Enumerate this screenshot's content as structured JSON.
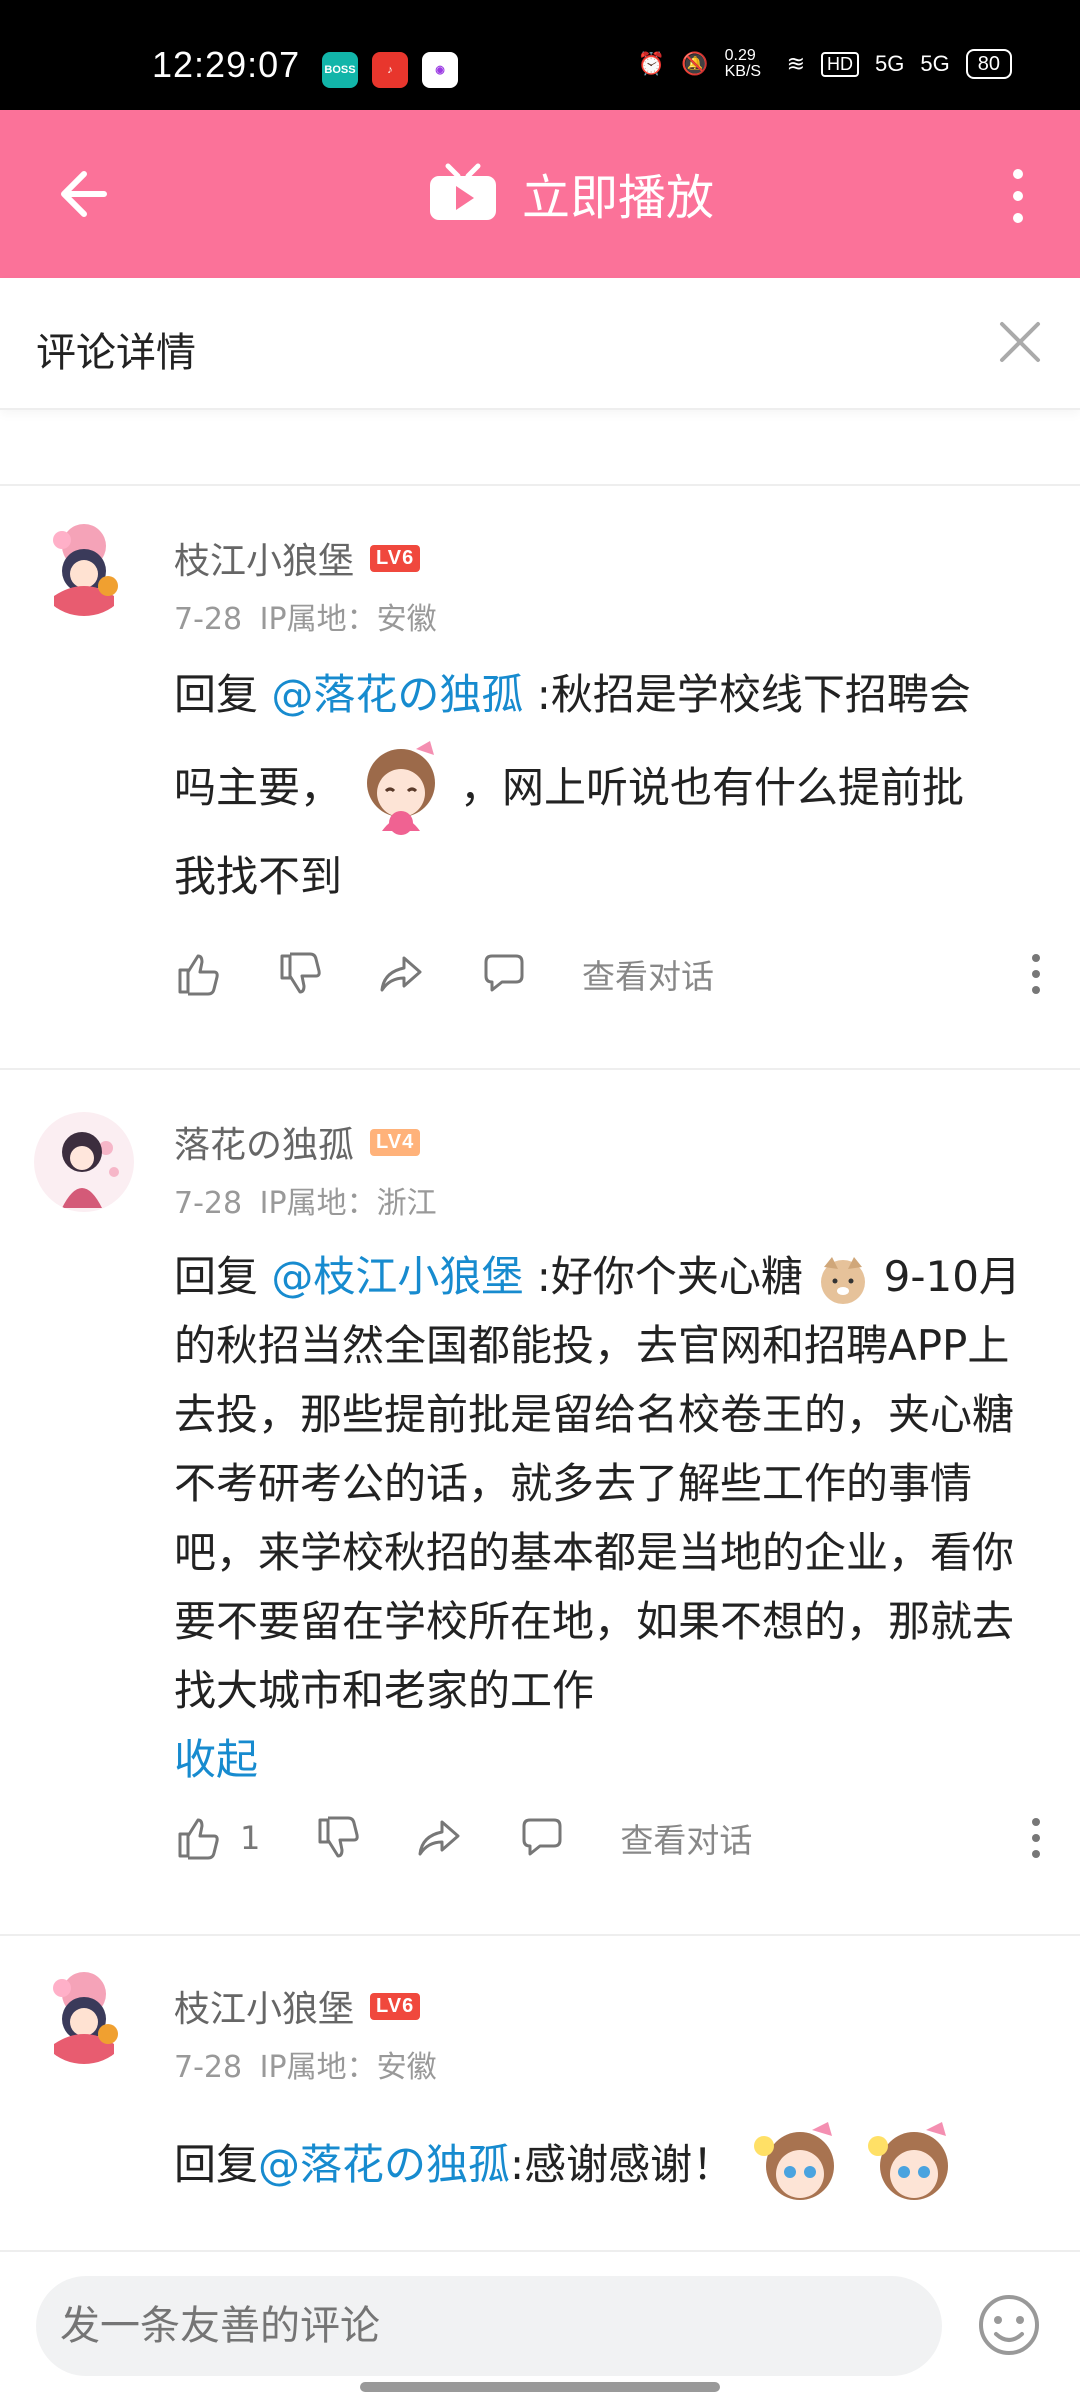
{
  "status_bar": {
    "time": "12:29:07",
    "apps": [
      "BOSS直聘",
      "抖音",
      "相机"
    ],
    "net_speed": "0.29 KB/S",
    "hd": "HD",
    "net1": "5G",
    "net2": "5G",
    "battery": "80"
  },
  "top_bar": {
    "play_label": "立即播放",
    "bg_color": "#fb7299"
  },
  "detail": {
    "title": "评论详情"
  },
  "comments": [
    {
      "user": "枝江小狼堡",
      "level": "LV6",
      "date": "7-28",
      "ip": "IP属地：安徽",
      "reply_prefix": "回复 ",
      "mention": "@落花の独孤",
      "text1": " :秋招是学校线下招聘会",
      "text2": "吗主要，",
      "text3": "，网上听说也有什么提前批",
      "text4": "我找不到",
      "view_conversation": "查看对话"
    },
    {
      "user": "落花の独孤",
      "level": "LV4",
      "date": "7-28",
      "ip": "IP属地：浙江",
      "reply_prefix": "回复 ",
      "mention": "@枝江小狼堡",
      "text1": " :好你个夹心糖",
      "text2": " 9-10月的秋招当然全国都能投，去官网和招聘APP上去投，那些提前批是留给名校卷王的，夹心糖不考研考公的话，就多去了解些工作的事情吧，来学校秋招的基本都是当地的企业，看你要不要留在学校所在地，如果不想的，那就去找大城市和老家的工作",
      "collapse": "收起",
      "likes": "1",
      "view_conversation": "查看对话"
    },
    {
      "user": "枝江小狼堡",
      "level": "LV6",
      "date": "7-28",
      "ip": "IP属地：安徽",
      "reply_prefix": "回复 ",
      "mention": "@落花の独孤",
      "text1": " :感谢感谢！"
    }
  ],
  "bottom_bar": {
    "placeholder": "发一条友善的评论"
  },
  "colors": {
    "mention": "#178bcf",
    "lv6": "#f0483d",
    "lv4": "#ffb27a"
  }
}
